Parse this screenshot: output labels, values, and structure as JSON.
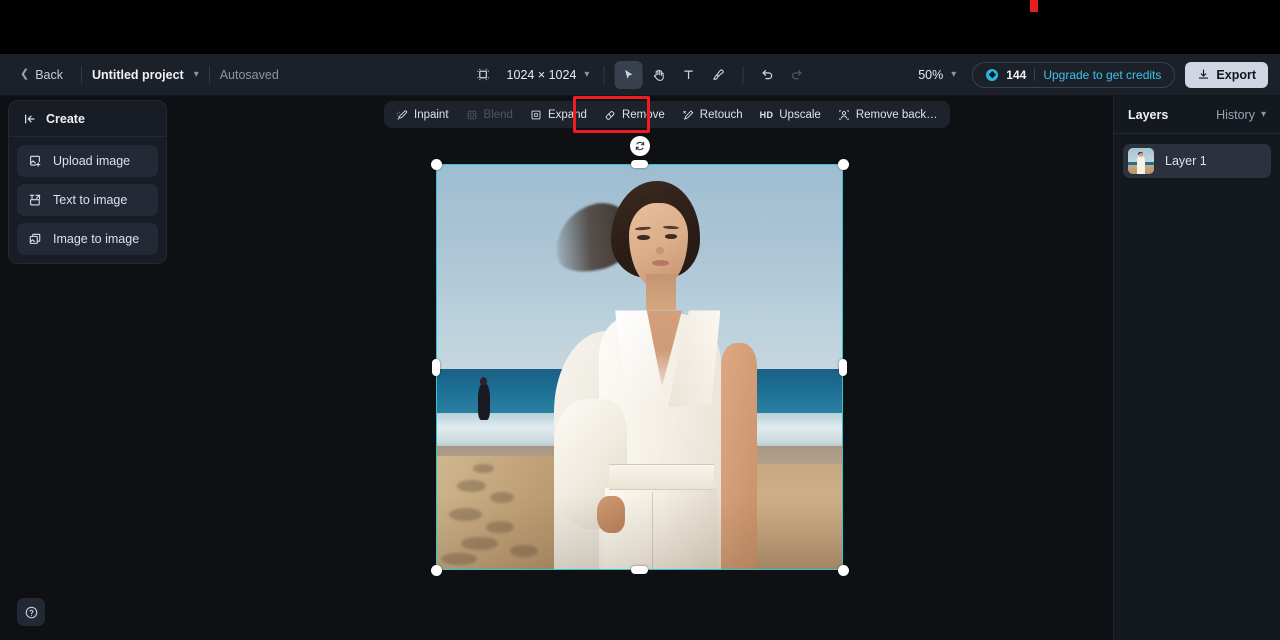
{
  "app": {
    "background_color": "#0e1014",
    "accent_color": "#3fc2ea",
    "selection_color": "#2ec8d2",
    "annotation_color": "#ee1c23"
  },
  "topbar": {
    "back_label": "Back",
    "project_name": "Untitled project",
    "project_chevron": "chevron-down-icon",
    "save_status": "Autosaved",
    "canvas_icon": "artboard-icon",
    "dimensions": "1024 × 1024",
    "dimensions_chevron": "chevron-down-icon",
    "tools": [
      {
        "name": "select-tool",
        "icon": "cursor-icon",
        "active": true,
        "disabled": false
      },
      {
        "name": "pan-tool",
        "icon": "hand-icon",
        "active": false,
        "disabled": false
      },
      {
        "name": "text-tool",
        "icon": "text-icon",
        "label": "T",
        "active": false,
        "disabled": false
      },
      {
        "name": "brush-tool",
        "icon": "brush-icon",
        "active": false,
        "disabled": false
      }
    ],
    "undo": {
      "icon": "undo-icon",
      "disabled": false
    },
    "redo": {
      "icon": "redo-icon",
      "disabled": true
    },
    "zoom_level": "50%",
    "zoom_chevron": "chevron-down-icon",
    "credits": {
      "icon": "coin-icon",
      "amount": "144",
      "upgrade_label": "Upgrade to get credits"
    },
    "export": {
      "label": "Export",
      "icon": "download-icon"
    }
  },
  "left_panel": {
    "title": "Create",
    "collapse_icon": "collapse-panel-icon",
    "items": [
      {
        "label": "Upload image",
        "icon": "upload-image-icon"
      },
      {
        "label": "Text to image",
        "icon": "text-to-image-icon"
      },
      {
        "label": "Image to image",
        "icon": "image-to-image-icon"
      }
    ]
  },
  "tool_strip": {
    "items": [
      {
        "label": "Inpaint",
        "icon": "inpaint-icon",
        "disabled": false,
        "highlighted": false
      },
      {
        "label": "Blend",
        "icon": "blend-icon",
        "disabled": true,
        "highlighted": false
      },
      {
        "label": "Expand",
        "icon": "expand-icon",
        "disabled": false,
        "highlighted": false
      },
      {
        "label": "Remove",
        "icon": "eraser-icon",
        "disabled": false,
        "highlighted": true
      },
      {
        "label": "Retouch",
        "icon": "retouch-icon",
        "disabled": false,
        "highlighted": false
      },
      {
        "label": "Upscale",
        "icon": "hd-icon",
        "badge": "HD",
        "disabled": false,
        "highlighted": false
      },
      {
        "label": "Remove back…",
        "icon": "remove-background-icon",
        "disabled": false,
        "highlighted": false
      }
    ]
  },
  "canvas": {
    "rotate_handle_icon": "rotate-icon",
    "image_description": "Woman in white outfit on a beach at sunset with ocean and a distant figure"
  },
  "right_panel": {
    "tab_layers": "Layers",
    "tab_history": "History",
    "history_chevron": "chevron-down-icon",
    "layers": [
      {
        "name": "Layer 1",
        "thumbnail": "layer-thumbnail"
      }
    ]
  },
  "help": {
    "icon": "help-icon",
    "label": "?"
  }
}
